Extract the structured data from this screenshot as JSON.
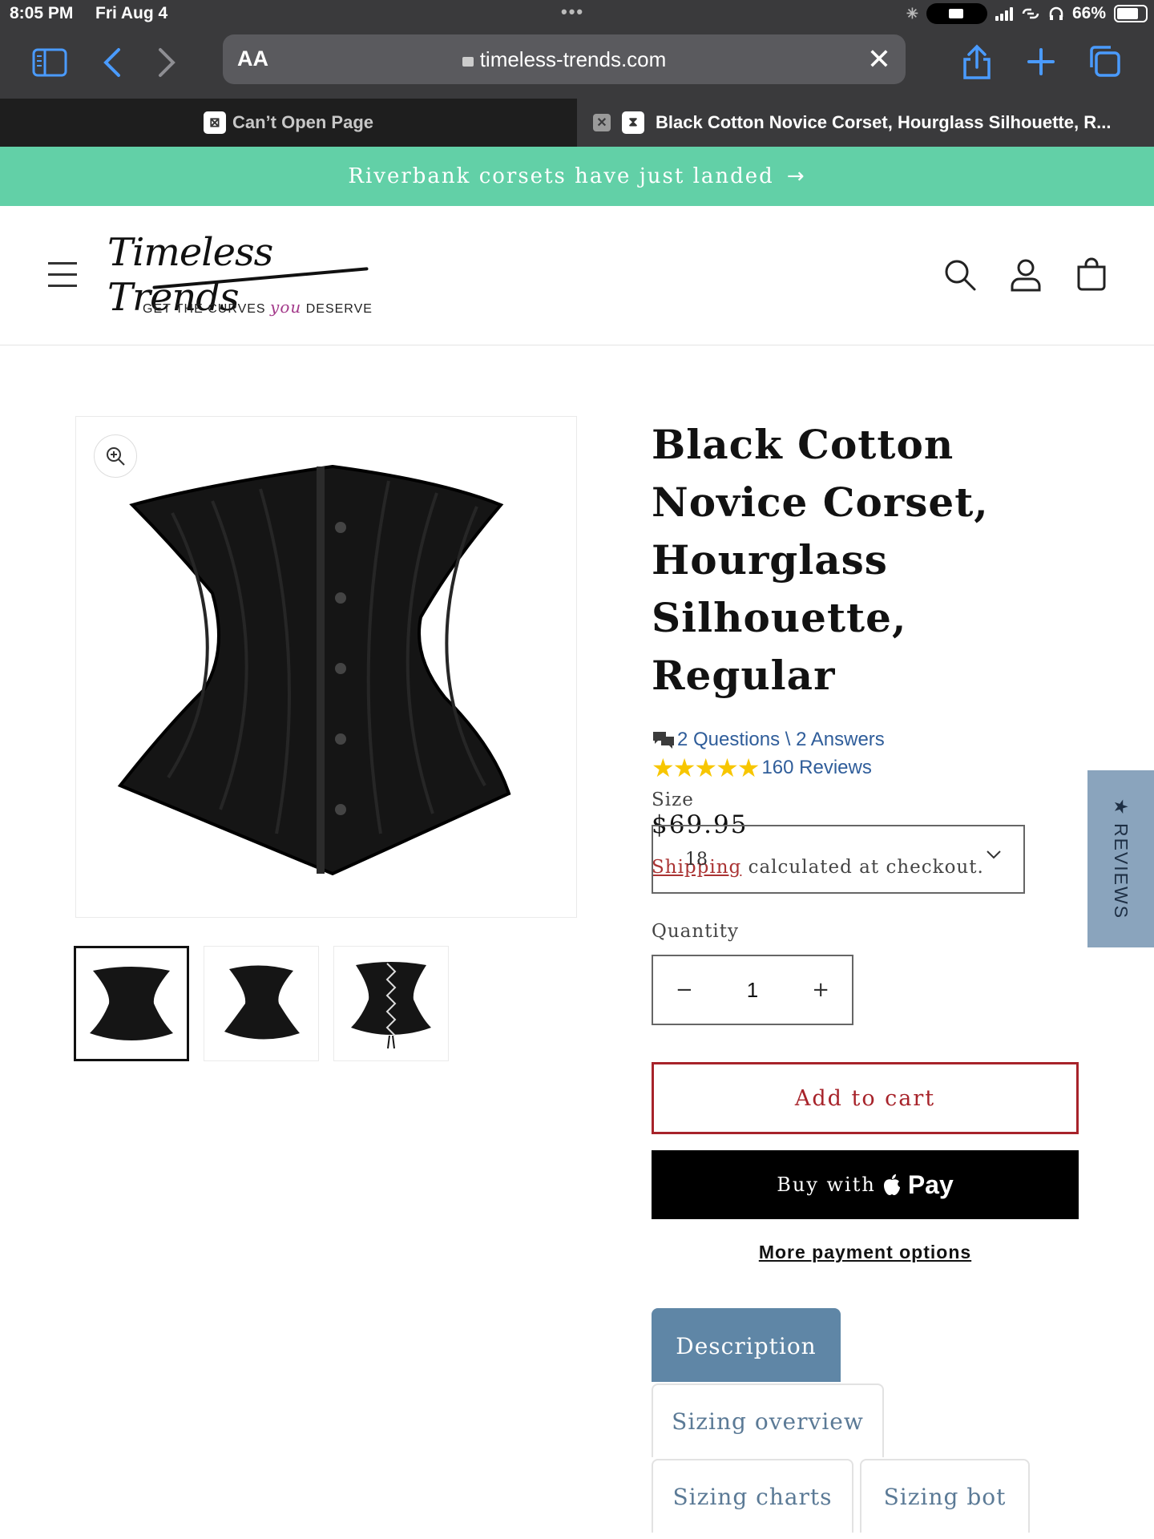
{
  "status_bar": {
    "time": "8:05 PM",
    "date": "Fri Aug 4",
    "battery": "66%"
  },
  "browser": {
    "text_size_label": "AA",
    "url": "timeless-trends.com",
    "tabs": [
      {
        "label": "Can’t Open Page",
        "active": false
      },
      {
        "label": "Black Cotton Novice Corset, Hourglass Silhouette, R...",
        "active": true
      }
    ]
  },
  "announcement": {
    "text": "Riverbank corsets have just landed"
  },
  "header": {
    "logo_script": "Timeless Trends",
    "logo_tag_prefix": "GET THE CURVES",
    "logo_tag_emph": "you",
    "logo_tag_suffix": "DESERVE"
  },
  "product": {
    "title": "Black Cotton Novice Corset, Hourglass Silhouette, Regular",
    "qa_text": "2 Questions \\ 2 Answers",
    "stars": "★★★★★",
    "reviews_text": "160 Reviews",
    "price": "$69.95",
    "shipping_link": "Shipping",
    "shipping_rest": " calculated at checkout.",
    "size_label": "Size",
    "size_value": "18",
    "quantity_label": "Quantity",
    "quantity_value": "1",
    "add_to_cart": "Add to cart",
    "buy_with": "Buy with",
    "pay_label": "Pay",
    "more_payment": "More payment options",
    "tabs": [
      "Description",
      "Sizing overview",
      "Sizing charts",
      "Sizing bot"
    ]
  },
  "side_reviews": {
    "label": "★ REVIEWS"
  },
  "colors": {
    "announcement_bg": "#62d0a7",
    "accent_red": "#a7232a",
    "tab_active": "#5f86a6",
    "star": "#f7c600",
    "link_blue": "#2f5d9a"
  }
}
